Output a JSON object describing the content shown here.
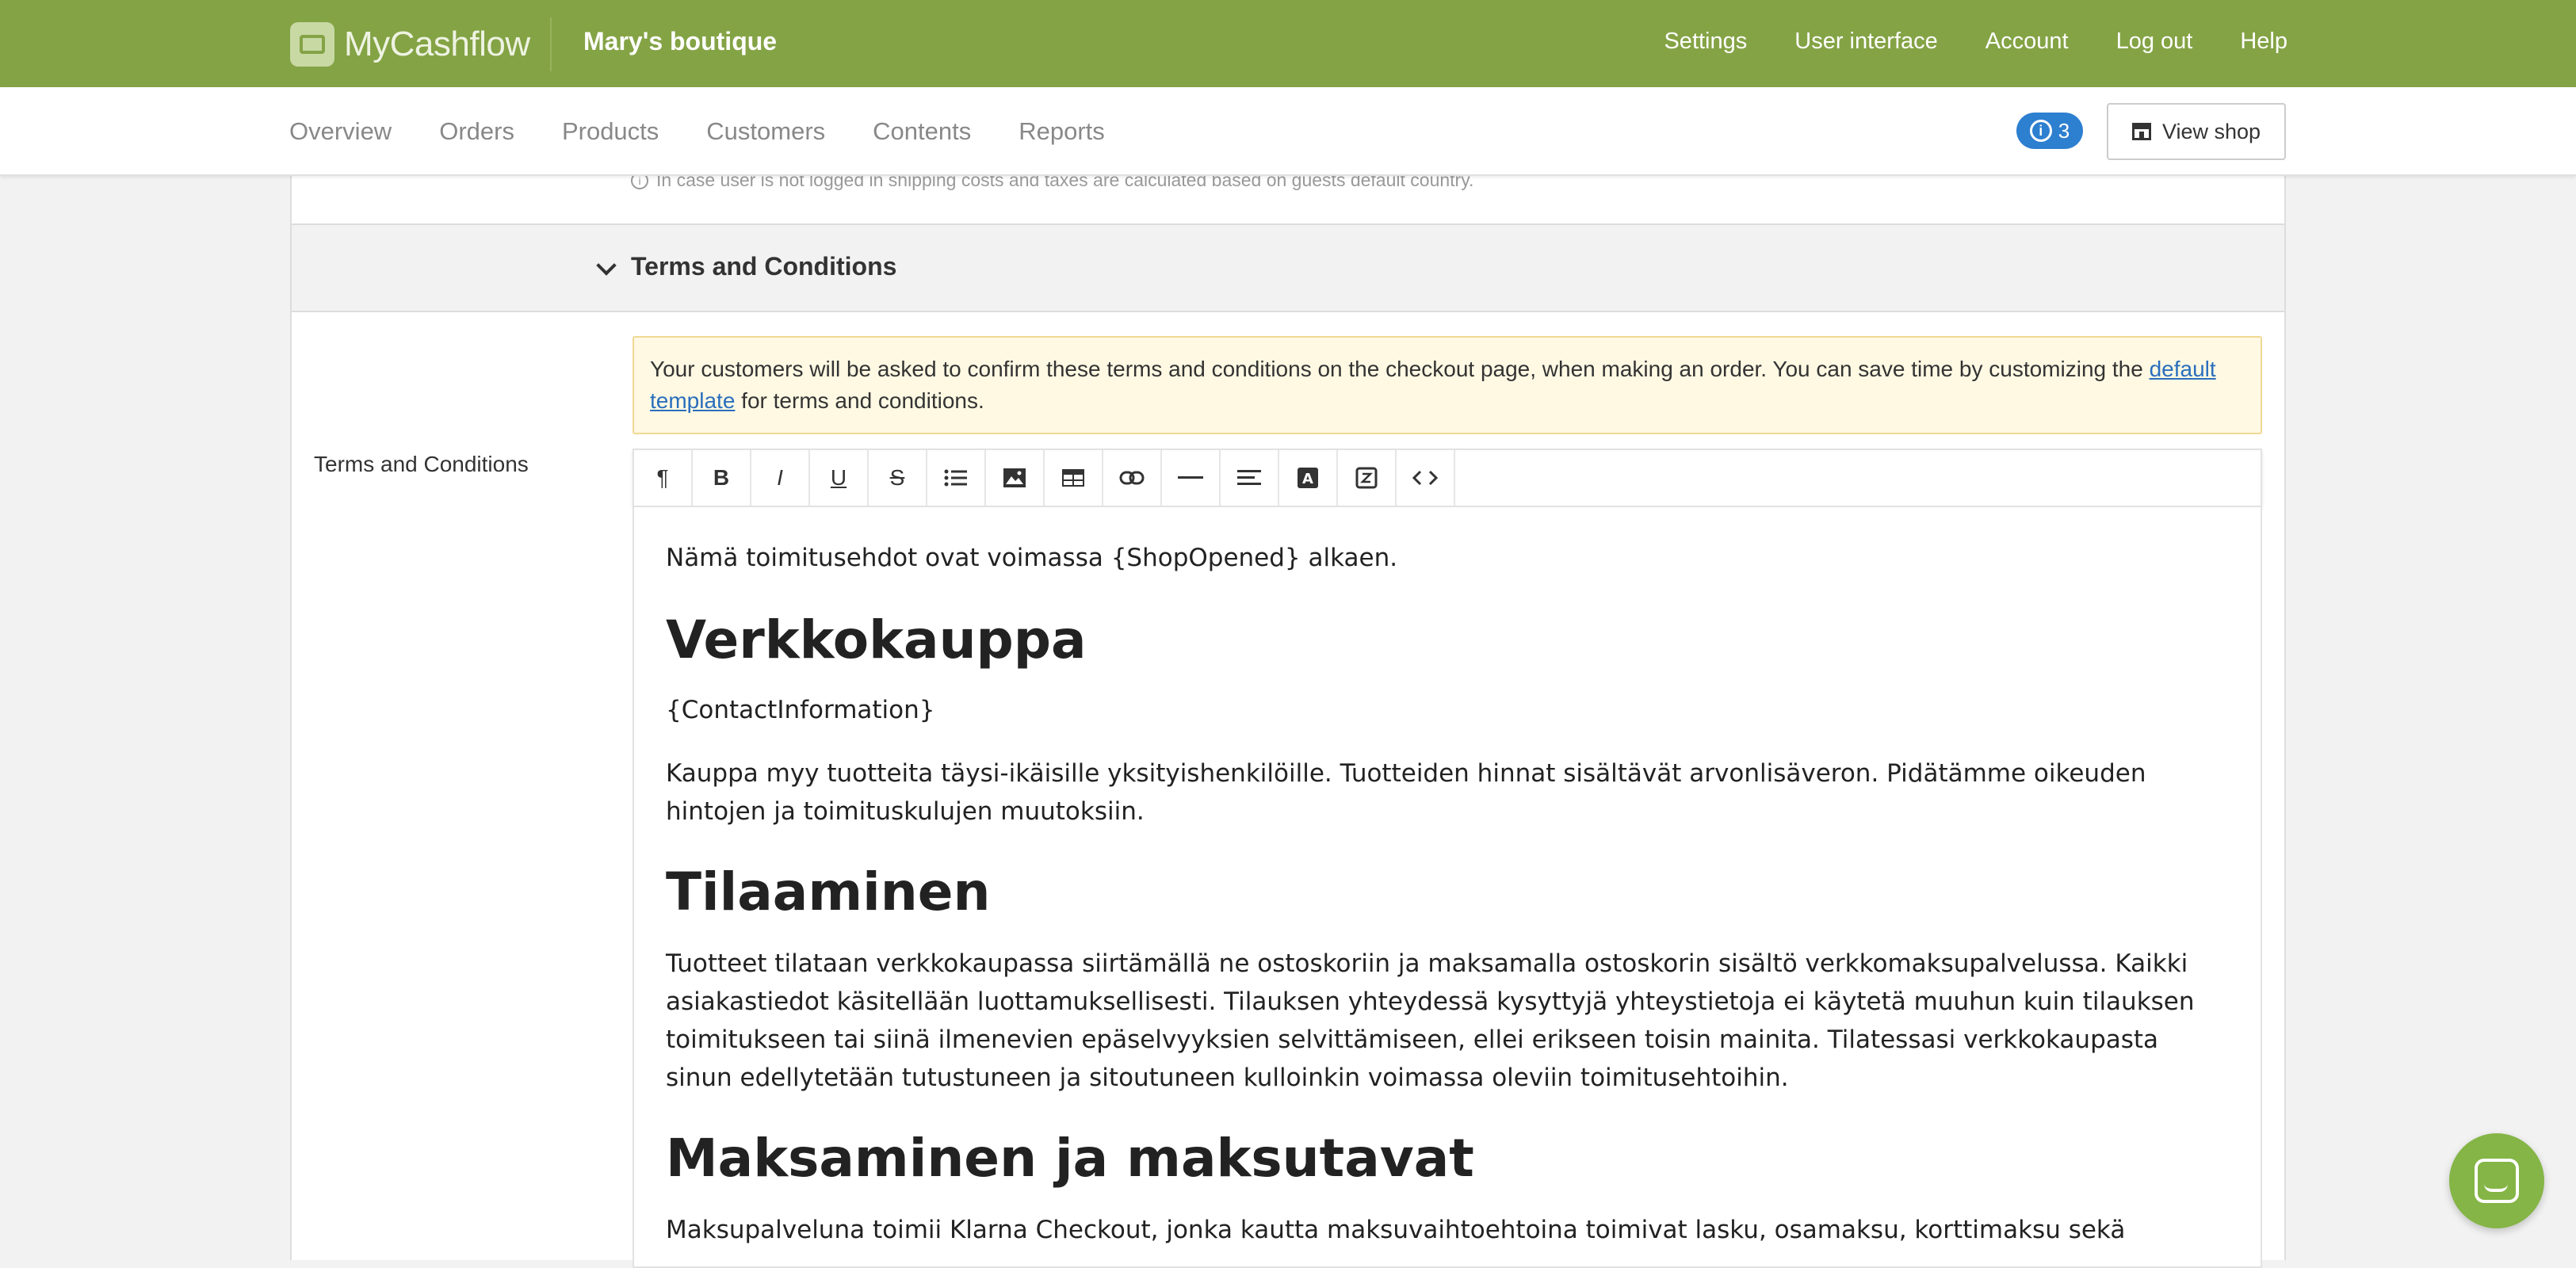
{
  "app": {
    "logo_text": "MyCashflow",
    "shop_name": "Mary's boutique"
  },
  "topnav": [
    "Settings",
    "User interface",
    "Account",
    "Log out",
    "Help"
  ],
  "subnav": [
    "Overview",
    "Orders",
    "Products",
    "Customers",
    "Contents",
    "Reports"
  ],
  "notifications": {
    "count": "3"
  },
  "view_shop_label": "View shop",
  "hint_text": "In case user is not logged in shipping costs and taxes are calculated based on guests default country.",
  "section": {
    "title": "Terms and Conditions"
  },
  "field_label": "Terms and Conditions",
  "notice": {
    "text_before": "Your customers will be asked to confirm these terms and conditions on the checkout page, when making an order. You can save time by customizing the ",
    "link": "default template",
    "text_after": " for terms and conditions."
  },
  "toolbar": [
    "paragraph-icon",
    "bold-icon",
    "italic-icon",
    "underline-icon",
    "strikethrough-icon",
    "list-icon",
    "image-icon",
    "table-icon",
    "link-icon",
    "horizontal-rule-icon",
    "align-icon",
    "text-color-icon",
    "snippet-icon",
    "code-icon"
  ],
  "editor": {
    "p1": "Nämä toimitusehdot ovat voimassa {ShopOpened} alkaen.",
    "h1": "Verkkokauppa",
    "p2": "{ContactInformation}",
    "p3": "Kauppa myy tuotteita täysi-ikäisille yksityishenkilöille. Tuotteiden hinnat sisältävät arvonlisäveron. Pidätämme oikeuden hintojen ja toimituskulujen muutoksiin.",
    "h2": "Tilaaminen",
    "p4": "Tuotteet tilataan verkkokaupassa siirtämällä ne ostoskoriin ja maksamalla ostoskorin sisältö verkkomaksupalvelussa. Kaikki asiakastiedot käsitellään luottamuksellisesti. Tilauksen yhteydessä kysyttyjä yhteystietoja ei käytetä muuhun kuin tilauksen toimitukseen tai siinä ilmenevien epäselvyyksien selvittämiseen, ellei erikseen toisin mainita. Tilatessasi verkkokaupasta sinun edellytetään tutustuneen ja sitoutuneen kulloinkin voimassa oleviin toimitusehtoihin.",
    "h3": "Maksaminen ja maksutavat",
    "p5": "Maksupalveluna toimii Klarna Checkout, jonka kautta maksuvaihtoehtoina toimivat lasku, osamaksu, korttimaksu sekä"
  },
  "colors": {
    "brand_green": "#84a345",
    "link_blue": "#2a6ebd",
    "badge_blue": "#2d7fd0"
  }
}
